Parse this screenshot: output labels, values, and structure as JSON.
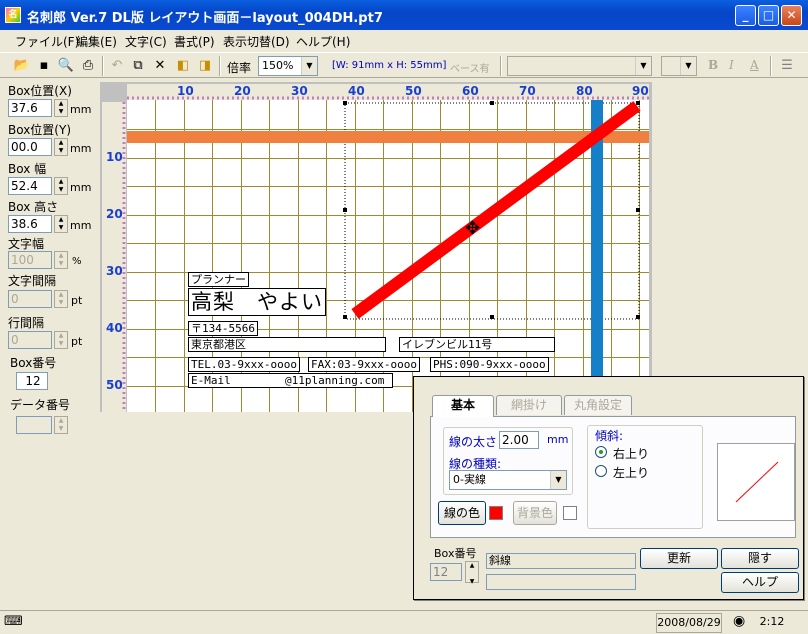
{
  "window": {
    "title": "名刺郎 Ver.7 DL版 レイアウト画面－layout_004DH.pt7",
    "app_icon_text": "名"
  },
  "titlebar_buttons": {
    "minimize": "_",
    "maximize": "□",
    "close": "✕"
  },
  "menu": [
    "ファイル(F)",
    "編集(E)",
    "文字(C)",
    "書式(P)",
    "表示切替(D)",
    "ヘルプ(H)"
  ],
  "toolbar": {
    "zoom_label": "倍率",
    "zoom_value": "150%",
    "size_text": "[W: 91mm x H: 55mm]",
    "base_text": "ベース有",
    "icons": [
      "open-icon",
      "save-icon",
      "preview-icon",
      "print-icon",
      "undo-icon",
      "copy-icon",
      "cut-icon",
      "front-icon",
      "back-icon"
    ],
    "bold": "B",
    "italic": "I",
    "underline": "A"
  },
  "left_panel": {
    "box_x_label": "Box位置(X)",
    "box_x_value": "37.6",
    "box_x_unit": "mm",
    "box_y_label": "Box位置(Y)",
    "box_y_value": "00.0",
    "box_y_unit": "mm",
    "box_w_label": "Box 幅",
    "box_w_value": "52.4",
    "box_w_unit": "mm",
    "box_h_label": "Box 高さ",
    "box_h_value": "38.6",
    "box_h_unit": "mm",
    "char_w_label": "文字幅",
    "char_w_value": "100",
    "char_w_unit": "%",
    "char_sp_label": "文字間隔",
    "char_sp_value": "0",
    "char_sp_unit": "pt",
    "line_sp_label": "行間隔",
    "line_sp_value": "0",
    "line_sp_unit": "pt",
    "box_no_label": "Box番号",
    "box_no_value": "12",
    "data_no_label": "データ番号",
    "data_no_value": ""
  },
  "ruler": {
    "x_ticks": [
      "10",
      "20",
      "30",
      "40",
      "50",
      "60",
      "70",
      "80",
      "90"
    ],
    "y_ticks": [
      "10",
      "20",
      "30",
      "40",
      "50"
    ]
  },
  "card": {
    "title": "プランナー",
    "name": "高梨　やよい",
    "zip": "〒134-5566",
    "address": "東京都港区",
    "building": "イレブンビル11号",
    "tel": "TEL.03-9xxx-oooo",
    "fax": "FAX:03-9xxx-oooo",
    "phs": "PHS:090-9xxx-oooo",
    "email_label": "E-Mail",
    "email_value": "@11planning.com"
  },
  "colors": {
    "orange_line": "#f08040",
    "blue_line": "#1580c8",
    "red_line": "#ff0000",
    "grid": "#a08a30"
  },
  "dialog": {
    "tabs": [
      "基本",
      "網掛け",
      "丸角設定"
    ],
    "line_width_label": "線の太さ",
    "line_width_value": "2.00",
    "line_width_unit": "mm",
    "line_type_label": "線の種類:",
    "line_type_value": "0-実線",
    "line_color_button": "線の色",
    "bg_color_button": "背景色",
    "slope_label": "傾斜:",
    "slope_up": "右上り",
    "slope_down": "左上り",
    "box_no_label": "Box番号",
    "box_no_value": "12",
    "box_name": "斜線",
    "box_name2": "",
    "update_button": "更新",
    "hide_button": "隠す",
    "help_button": "ヘルプ"
  },
  "status": {
    "date": "2008/08/29",
    "time": "2:12"
  }
}
